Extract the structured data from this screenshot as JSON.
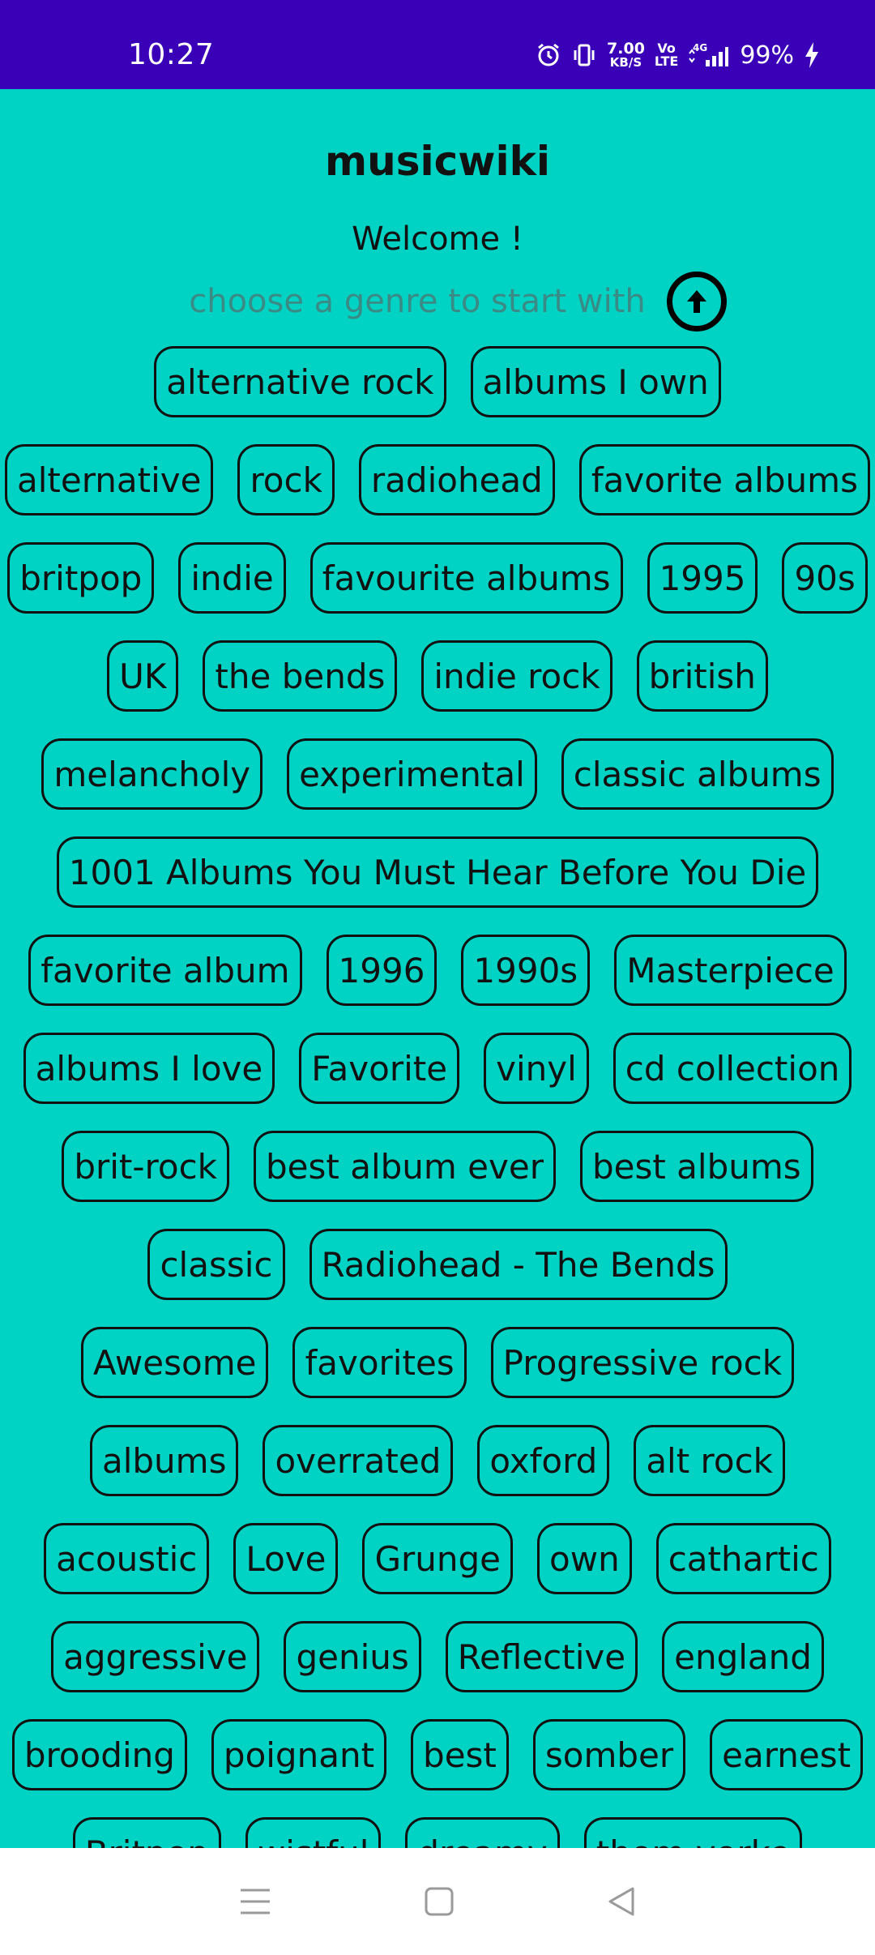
{
  "status_bar": {
    "time": "10:27",
    "net_speed_value": "7.00",
    "net_speed_unit": "KB/S",
    "volte_top": "Vo",
    "volte_bottom": "LTE",
    "network": "4G",
    "battery": "99%"
  },
  "header": {
    "title": "musicwiki",
    "welcome": "Welcome !",
    "prompt": "choose a genre to start with",
    "up_button_icon": "arrow-up-circle-icon"
  },
  "tags": {
    "rows": [
      [
        "alternative rock",
        "albums I own"
      ],
      [
        "alternative",
        "rock",
        "radiohead",
        "favorite albums"
      ],
      [
        "britpop",
        "indie",
        "favourite albums",
        "1995",
        "90s"
      ],
      [
        "UK",
        "the bends",
        "indie rock",
        "british"
      ],
      [
        "melancholy",
        "experimental",
        "classic albums"
      ],
      [
        "1001 Albums You Must Hear Before You Die"
      ],
      [
        "favorite album",
        "1996",
        "1990s",
        "Masterpiece"
      ],
      [
        "albums I love",
        "Favorite",
        "vinyl",
        "cd collection"
      ],
      [
        "brit-rock",
        "best album ever",
        "best albums"
      ],
      [
        "classic",
        "Radiohead - The Bends"
      ],
      [
        "Awesome",
        "favorites",
        "Progressive rock"
      ],
      [
        "albums",
        "overrated",
        "oxford",
        "alt rock"
      ],
      [
        "acoustic",
        "Love",
        "Grunge",
        "own",
        "cathartic"
      ],
      [
        "aggressive",
        "genius",
        "Reflective",
        "england"
      ],
      [
        "brooding",
        "poignant",
        "best",
        "somber",
        "earnest"
      ],
      [
        "Britpop",
        "wistful",
        "dreamy",
        "thom yorke"
      ]
    ]
  },
  "nav": {
    "menu_icon": "menu-icon",
    "home_icon": "home-square-icon",
    "back_icon": "back-triangle-icon"
  },
  "colors": {
    "status_bar": "#3a00b8",
    "background": "#00d3c3",
    "tag_border": "#111111",
    "prompt_text": "#3a8a86"
  }
}
